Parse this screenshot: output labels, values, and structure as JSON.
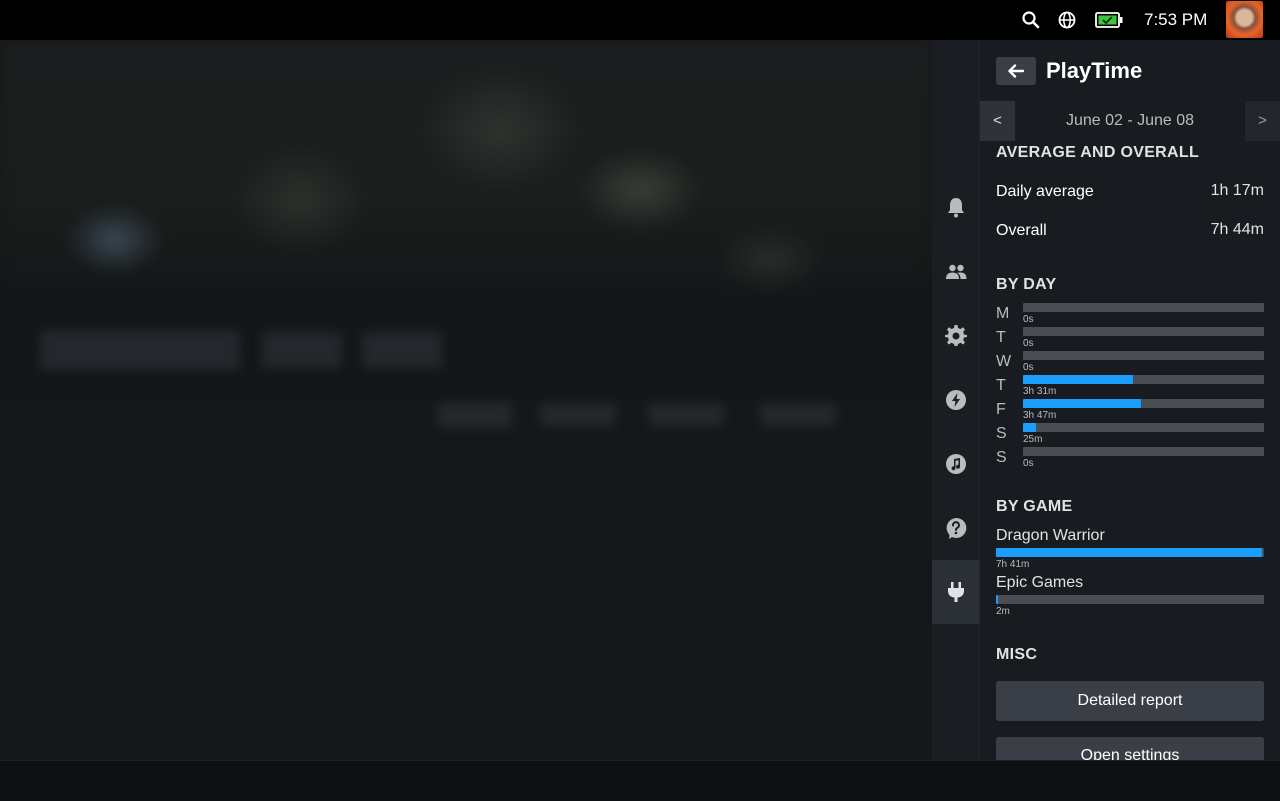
{
  "status": {
    "time": "7:53 PM",
    "icons": [
      "search-icon",
      "globe-icon",
      "battery-icon"
    ]
  },
  "rail": {
    "items": [
      "bell-icon",
      "friends-icon",
      "gear-icon",
      "lightning-icon",
      "music-icon",
      "help-icon",
      "plug-icon"
    ],
    "active": "plug-icon"
  },
  "panel": {
    "title": "PlayTime",
    "prev_label": "<",
    "next_label": ">",
    "range": "June 02 - June 08",
    "overall_section": {
      "heading": "AVERAGE AND OVERALL",
      "daily_average_label": "Daily average",
      "daily_average_value": "1h 17m",
      "overall_label": "Overall",
      "overall_value": "7h 44m"
    },
    "by_day": {
      "heading": "BY DAY",
      "days": [
        {
          "letter": "M",
          "value": "0s",
          "fraction": 0.0
        },
        {
          "letter": "T",
          "value": "0s",
          "fraction": 0.0
        },
        {
          "letter": "W",
          "value": "0s",
          "fraction": 0.0
        },
        {
          "letter": "T",
          "value": "3h 31m",
          "fraction": 0.455
        },
        {
          "letter": "F",
          "value": "3h 47m",
          "fraction": 0.488
        },
        {
          "letter": "S",
          "value": "25m",
          "fraction": 0.054
        },
        {
          "letter": "S",
          "value": "0s",
          "fraction": 0.0
        }
      ]
    },
    "by_game": {
      "heading": "BY GAME",
      "games": [
        {
          "name": "Dragon Warrior",
          "value": "7h 41m",
          "fraction": 0.994
        },
        {
          "name": "Epic Games",
          "value": "2m",
          "fraction": 0.005
        }
      ]
    },
    "misc": {
      "heading": "MISC",
      "detailed_report": "Detailed report",
      "open_settings": "Open settings"
    }
  },
  "colors": {
    "accent": "#1a9fff",
    "track": "#4a4d52",
    "panel_bg": "#181b20"
  }
}
